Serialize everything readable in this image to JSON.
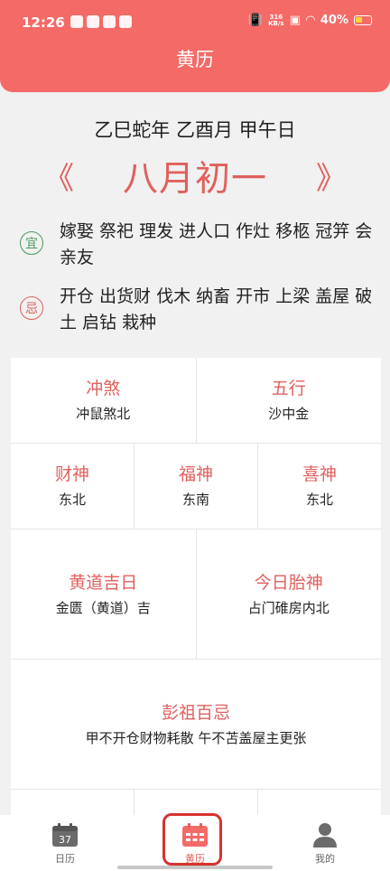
{
  "status_bar": {
    "time": "12:26",
    "net_speed_value": "316",
    "net_speed_unit": "KB/s",
    "battery": "40%"
  },
  "header": {
    "title": "黄历"
  },
  "ganzhi": "乙巳蛇年 乙酉月 甲午日",
  "lunar": {
    "prev": "《",
    "date": "八月初一",
    "next": "》"
  },
  "yi": {
    "badge": "宜",
    "text": "嫁娶 祭祀 理发 进人口 作灶 移柩 冠笄 会亲友"
  },
  "ji": {
    "badge": "忌",
    "text": "开仓 出货财 伐木 纳畜 开市 上梁 盖屋 破土 启钻 栽种"
  },
  "grid": {
    "chongsha": {
      "label": "冲煞",
      "value": "冲鼠煞北"
    },
    "wuxing": {
      "label": "五行",
      "value": "沙中金"
    },
    "caishen": {
      "label": "财神",
      "value": "东北"
    },
    "fushen": {
      "label": "福神",
      "value": "东南"
    },
    "xishen": {
      "label": "喜神",
      "value": "东北"
    },
    "huangdao": {
      "label": "黄道吉日",
      "value": "金匮（黄道）吉"
    },
    "taishen": {
      "label": "今日胎神",
      "value": "占门碓房内北"
    },
    "pengzu": {
      "label": "彭祖百忌",
      "value": "甲不开仓财物耗散 午不苫盖屋主更张"
    }
  },
  "tabs": [
    {
      "label": "日历",
      "icon_number": "37"
    },
    {
      "label": "黄历"
    },
    {
      "label": "我的"
    }
  ],
  "colors": {
    "primary": "#f46a67",
    "accent": "#e0605d",
    "yi_green": "#4d9a5d",
    "highlight": "#d7322e"
  }
}
